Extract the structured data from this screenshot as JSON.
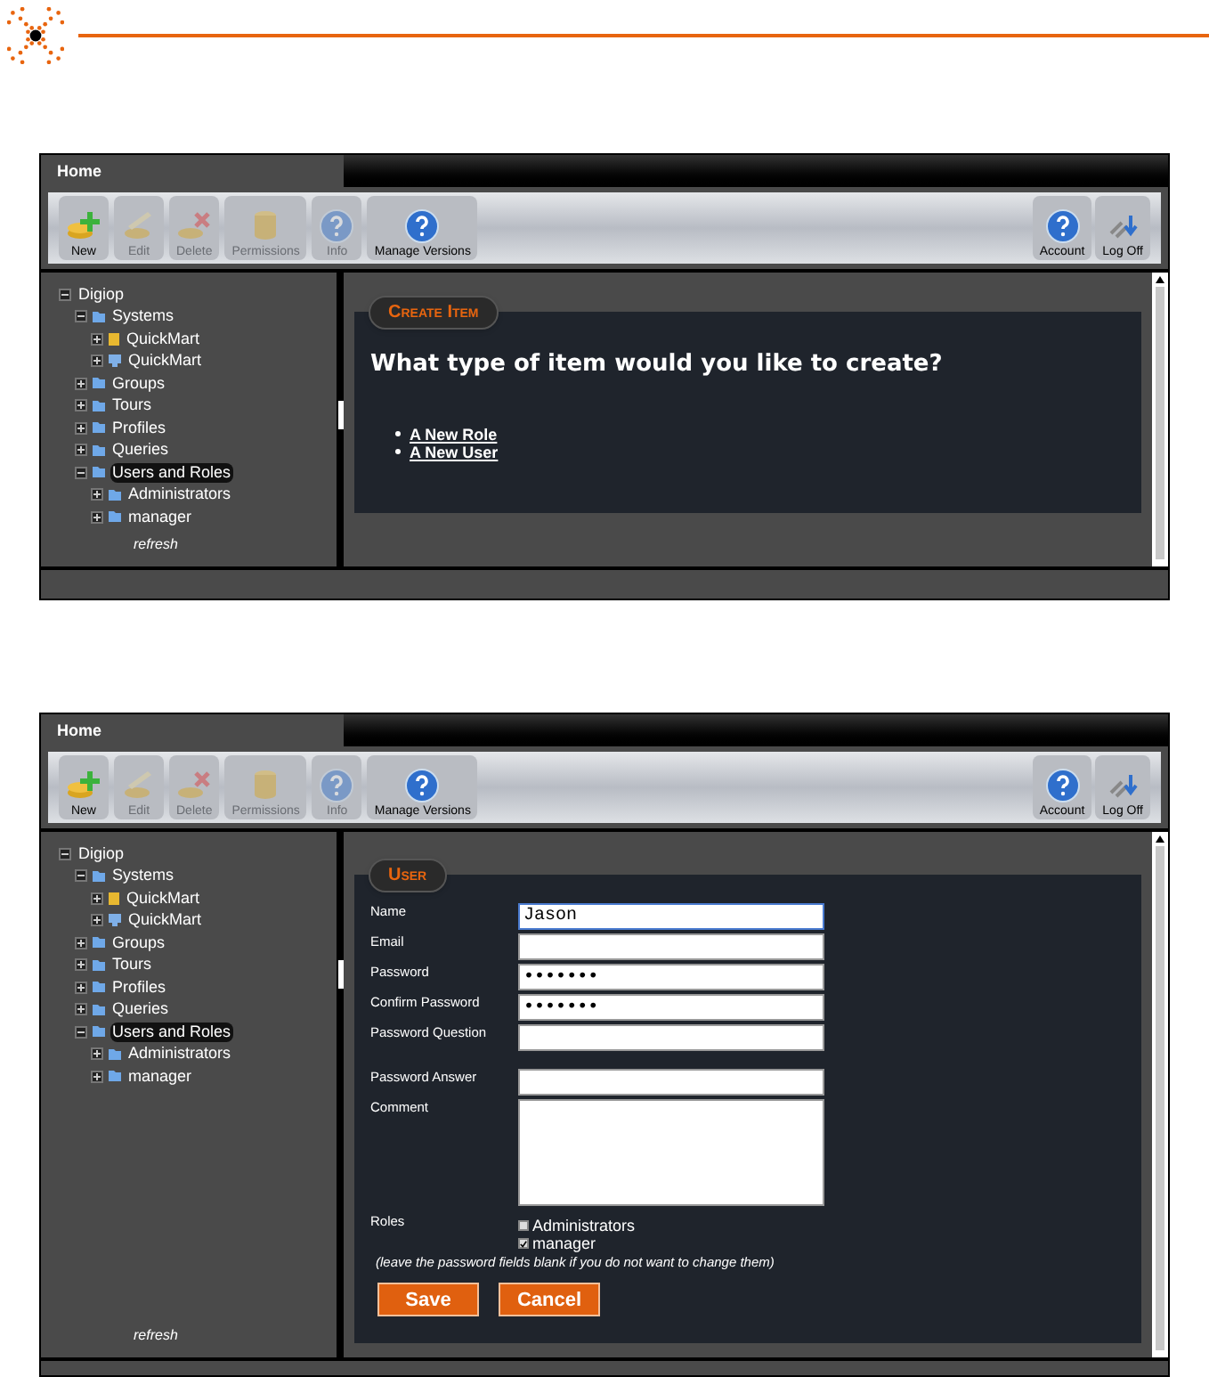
{
  "screens": [
    {
      "tab": "Home",
      "toolbar": [
        {
          "label": "New",
          "kind": "new",
          "disabled": false
        },
        {
          "label": "Edit",
          "kind": "edit",
          "disabled": true
        },
        {
          "label": "Delete",
          "kind": "delete",
          "disabled": true
        },
        {
          "label": "Permissions",
          "kind": "permissions",
          "disabled": true
        },
        {
          "label": "Info",
          "kind": "help",
          "disabled": true
        },
        {
          "label": "Manage Versions",
          "kind": "help",
          "disabled": false
        }
      ],
      "right_tools": [
        {
          "label": "Account",
          "kind": "help",
          "disabled": false
        },
        {
          "label": "Log Off",
          "kind": "logoff",
          "disabled": false
        }
      ],
      "tree": [
        {
          "label": "Digiop",
          "expanded": true,
          "selected": false,
          "children": [
            {
              "label": "Systems",
              "kind": "folder",
              "expanded": true,
              "selected": false,
              "children": [
                {
                  "label": "QuickMart",
                  "kind": "database",
                  "expanded": false,
                  "selected": false
                },
                {
                  "label": "QuickMart",
                  "kind": "monitor",
                  "expanded": false,
                  "selected": false
                }
              ]
            },
            {
              "label": "Groups",
              "kind": "folder",
              "expanded": false,
              "selected": false
            },
            {
              "label": "Tours",
              "kind": "folder",
              "expanded": false,
              "selected": false
            },
            {
              "label": "Profiles",
              "kind": "folder",
              "expanded": false,
              "selected": false
            },
            {
              "label": "Queries",
              "kind": "folder",
              "expanded": false,
              "selected": false
            },
            {
              "label": "Users and Roles",
              "kind": "folder",
              "expanded": true,
              "selected": true,
              "children": [
                {
                  "label": "Administrators",
                  "kind": "folder",
                  "expanded": false,
                  "selected": false
                },
                {
                  "label": "manager",
                  "kind": "folder",
                  "expanded": false,
                  "selected": false
                }
              ]
            }
          ]
        }
      ],
      "refresh": "refresh",
      "panel": {
        "kind": "create",
        "title": "Create Item",
        "question": "What type of item would you like to create?",
        "links": [
          "A New Role",
          "A New User"
        ]
      }
    },
    {
      "tab": "Home",
      "toolbar": [
        {
          "label": "New",
          "kind": "new",
          "disabled": false
        },
        {
          "label": "Edit",
          "kind": "edit",
          "disabled": true
        },
        {
          "label": "Delete",
          "kind": "delete",
          "disabled": true
        },
        {
          "label": "Permissions",
          "kind": "permissions",
          "disabled": true
        },
        {
          "label": "Info",
          "kind": "help",
          "disabled": true
        },
        {
          "label": "Manage Versions",
          "kind": "help",
          "disabled": false
        }
      ],
      "right_tools": [
        {
          "label": "Account",
          "kind": "help",
          "disabled": false
        },
        {
          "label": "Log Off",
          "kind": "logoff",
          "disabled": false
        }
      ],
      "tree": [
        {
          "label": "Digiop",
          "expanded": true,
          "selected": false,
          "children": [
            {
              "label": "Systems",
              "kind": "folder",
              "expanded": true,
              "selected": false,
              "children": [
                {
                  "label": "QuickMart",
                  "kind": "database",
                  "expanded": false,
                  "selected": false
                },
                {
                  "label": "QuickMart",
                  "kind": "monitor",
                  "expanded": false,
                  "selected": false
                }
              ]
            },
            {
              "label": "Groups",
              "kind": "folder",
              "expanded": false,
              "selected": false
            },
            {
              "label": "Tours",
              "kind": "folder",
              "expanded": false,
              "selected": false
            },
            {
              "label": "Profiles",
              "kind": "folder",
              "expanded": false,
              "selected": false
            },
            {
              "label": "Queries",
              "kind": "folder",
              "expanded": false,
              "selected": false
            },
            {
              "label": "Users and Roles",
              "kind": "folder",
              "expanded": true,
              "selected": true,
              "children": [
                {
                  "label": "Administrators",
                  "kind": "folder",
                  "expanded": false,
                  "selected": false
                },
                {
                  "label": "manager",
                  "kind": "folder",
                  "expanded": false,
                  "selected": false
                }
              ]
            }
          ]
        }
      ],
      "refresh": "refresh",
      "panel": {
        "kind": "user",
        "title": "User",
        "fields": [
          {
            "label": "Name",
            "kind": "text",
            "value": "Jason",
            "focused": true
          },
          {
            "label": "Email",
            "kind": "text",
            "focused": false
          },
          {
            "label": "Password",
            "kind": "password",
            "value": "•••••••",
            "focused": false
          },
          {
            "label": "Confirm Password",
            "kind": "password",
            "value": "•••••••",
            "focused": false
          },
          {
            "label": "Password Question",
            "kind": "text",
            "focused": false
          },
          {
            "label": "Password Answer",
            "kind": "text",
            "focused": false
          },
          {
            "label": "Comment",
            "kind": "textarea",
            "focused": false
          }
        ],
        "roles_label": "Roles",
        "roles": [
          {
            "label": "Administrators",
            "checked": false
          },
          {
            "label": "manager",
            "checked": true
          }
        ],
        "note": "(leave the password fields blank if you do not want to change them)",
        "buttons": [
          "Save",
          "Cancel"
        ]
      }
    }
  ]
}
